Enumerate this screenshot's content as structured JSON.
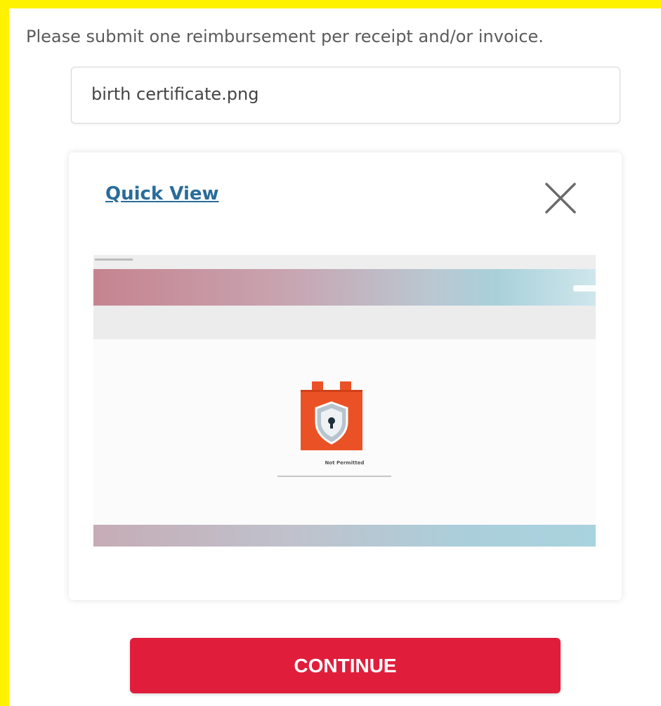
{
  "colors": {
    "frame_border": "#fff200",
    "link": "#2a6c9a",
    "primary_button": "#e01e3c"
  },
  "instructions": {
    "text": "Please submit one reimbursement per receipt and/or invoice."
  },
  "upload": {
    "file_name": "birth certificate.png"
  },
  "quick_view": {
    "title": "Quick View",
    "close_icon": "close-icon",
    "preview": {
      "message_title": "Not Permitted",
      "lock_icon": "castle-lock-icon"
    }
  },
  "actions": {
    "continue_label": "CONTINUE"
  }
}
